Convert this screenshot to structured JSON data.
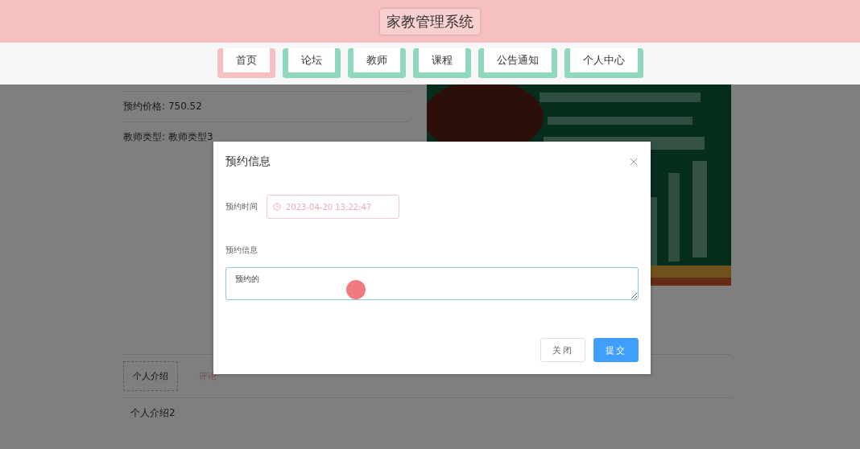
{
  "header": {
    "title": "家教管理系统"
  },
  "nav": [
    {
      "label": "首页",
      "selected": true
    },
    {
      "label": "论坛",
      "selected": false
    },
    {
      "label": "教师",
      "selected": false
    },
    {
      "label": "课程",
      "selected": false
    },
    {
      "label": "公告通知",
      "selected": false
    },
    {
      "label": "个人中心",
      "selected": false
    }
  ],
  "details": [
    {
      "label": "预约价格:",
      "value": "750.52"
    },
    {
      "label": "教师类型:",
      "value": "教师类型3"
    }
  ],
  "tabs": [
    {
      "label": "个人介绍",
      "selected": true
    },
    {
      "label": "评论",
      "selected": false
    }
  ],
  "tab_content": "个人介绍2",
  "dialog": {
    "title": "预约信息",
    "fields": [
      {
        "kind": "datetime",
        "label": "预约时间",
        "value": "2023-04-20 13:22:47"
      },
      {
        "kind": "textarea",
        "label": "预约信息",
        "value": "预约的"
      }
    ],
    "buttons": [
      {
        "label": "关闭",
        "kind": "default"
      },
      {
        "label": "提交",
        "kind": "primary"
      }
    ]
  }
}
